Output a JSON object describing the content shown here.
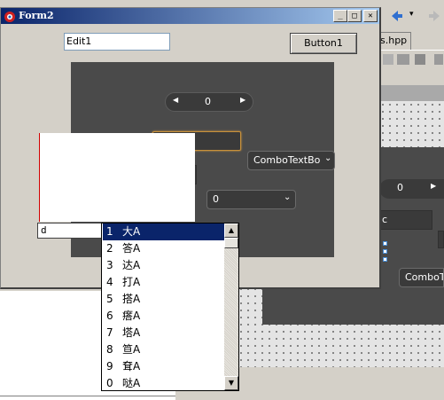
{
  "ide": {
    "tab_label": "s.hpp"
  },
  "form": {
    "title": "Form2",
    "minimize_glyph": "_",
    "maximize_glyph": "□",
    "close_glyph": "✕"
  },
  "controls": {
    "edit1_value": "Edit1",
    "button1_label": "Button1",
    "spin_value": "0",
    "combotext_value": "ComboTextBo",
    "combo0_value": "0",
    "d_edit_value": "d"
  },
  "ide_widgets": {
    "spin_value": "0",
    "edit_value": "c",
    "combo_value": "ComboTe"
  },
  "dropdown": {
    "items": [
      {
        "num": "1",
        "label": "大A"
      },
      {
        "num": "2",
        "label": "答A"
      },
      {
        "num": "3",
        "label": "达A"
      },
      {
        "num": "4",
        "label": "打A"
      },
      {
        "num": "5",
        "label": "搭A"
      },
      {
        "num": "6",
        "label": "瘩A"
      },
      {
        "num": "7",
        "label": "塔A"
      },
      {
        "num": "8",
        "label": "笪A"
      },
      {
        "num": "9",
        "label": "耷A"
      },
      {
        "num": "0",
        "label": "哒A"
      }
    ],
    "selected_index": 0
  },
  "colors": {
    "title_start": "#0a246a",
    "title_end": "#a6caf0",
    "panel": "#4a4a4a",
    "selection": "#0a246a",
    "focus_border": "#c9913a"
  }
}
